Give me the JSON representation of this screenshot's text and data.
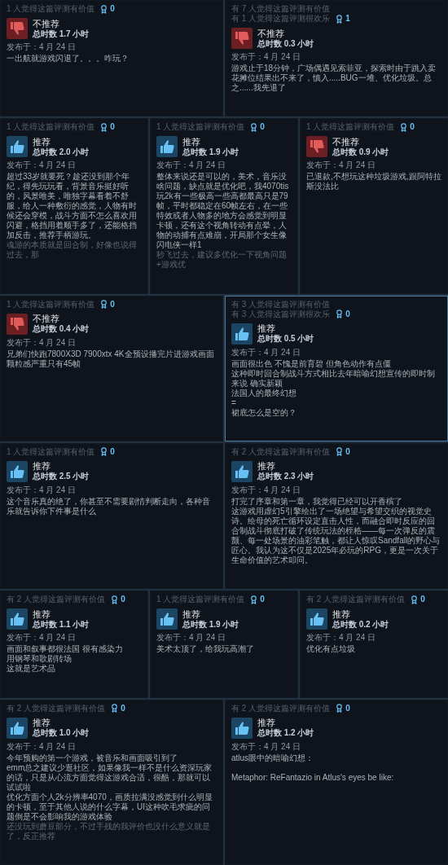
{
  "rows": [
    {
      "reviews": [
        {
          "helpful": [
            "1 人觉得这篇评测有价值"
          ],
          "awards": "0",
          "kind": "down",
          "verdict": "不推荐",
          "hours": "总时数 1.7 小时",
          "posted": "发布于：4 月 24 日",
          "lines": [
            "一出航就游戏闪退了。。。咋玩？"
          ],
          "highlighted": false
        },
        {
          "helpful": [
            "有 7 人觉得这篇评测有价值",
            "有 1 人觉得这篇评测很欢乐"
          ],
          "awards": "1",
          "kind": "down",
          "verdict": "不推荐",
          "hours": "总时数 0.3 小时",
          "posted": "发布于：4 月 24 日",
          "lines": [
            "游戏止于18分钟，广场偶遇见索菲亚，探索时由于跳入卖花摊位结果出不来了，慎入.....BUG一堆、优化垃圾。总之......我先退了"
          ],
          "highlighted": false
        }
      ]
    },
    {
      "reviews": [
        {
          "helpful": [
            "1 人觉得这篇评测有价值"
          ],
          "awards": "0",
          "kind": "up",
          "verdict": "推荐",
          "hours": "总时数 2.0 小时",
          "posted": "发布于：4 月 24 日",
          "lines": [
            "超过33岁就要死？趁还没到那个年纪，得先玩玩看，背景音乐挺好听的，风景唯美，唯独字幕看着不舒服，给人一种敷衍的感觉，人物有时候还会穿模，战斗方面不怎么喜欢用闪避，格挡用着顺手多了，还能格挡加反击，推荐手柄游玩。"
          ],
          "faded": "魂游的本质就是回合制，好像也说得过去，那",
          "highlighted": false
        },
        {
          "helpful": [
            "1 人觉得这篇评测有价值"
          ],
          "awards": "0",
          "kind": "up",
          "verdict": "推荐",
          "hours": "总时数 1.9 小时",
          "posted": "发布于：4 月 24 日",
          "lines": [
            "整体来说还是可以的，美术，音乐没啥问题，缺点就是优化吧，我4070tis玩2k有一些极高一些高都最高只是79帧，平时都稳定在60帧左右，在一些特效或者人物多的地方会感觉到明显卡顿，还有这个视角转动有点晕，人物的动捕有点难崩，开局那个女生像闪电侠一样1"
          ],
          "faded": "秒飞过去，建议多优化一下视角问题+游戏优",
          "highlighted": false
        },
        {
          "helpful": [
            "1 人觉得这篇评测有价值"
          ],
          "awards": "0",
          "kind": "down",
          "verdict": "不推荐",
          "hours": "总时数 0.9 小时",
          "posted": "发布于：4 月 24 日",
          "lines": [
            "已退款,不想玩这种垃圾游戏,跟阿特拉斯没法比"
          ],
          "highlighted": false
        }
      ]
    },
    {
      "reviews": [
        {
          "helpful": [
            "1 人觉得这篇评测有价值"
          ],
          "awards": "0",
          "kind": "down",
          "verdict": "不推荐",
          "hours": "总时数 0.4 小时",
          "posted": "发布于：4 月 24 日",
          "lines": [
            "兄弟们快跑7800X3D 7900xtx 4K全预设播完片进游戏画面颗粒感严重只有45帧"
          ],
          "highlighted": false
        },
        {
          "helpful": [
            "有 3 人觉得这篇评测有价值",
            "有 3 人觉得这篇评测很欢乐"
          ],
          "awards": "0",
          "kind": "up",
          "verdict": "推荐",
          "hours": "总时数 0.5 小时",
          "posted": "发布于：4 月 24 日",
          "lines": [
            "画面很出色 不愧是前育碧 但角色动作有点僵",
            "这种即时回合制战斗方式相比去年暗喻幻想宣传的即时制来说 确实新颖",
            "法国人的最终幻想",
            "=",
            "裙底怎么是空的？"
          ],
          "highlighted": true
        }
      ]
    },
    {
      "reviews": [
        {
          "helpful": [
            "1 人觉得这篇评测有价值"
          ],
          "awards": "0",
          "kind": "up",
          "verdict": "推荐",
          "hours": "总时数 2.5 小时",
          "posted": "发布于：4 月 24 日",
          "lines": [
            "这个音乐真的绝了，你甚至不需要剧情判断走向，各种音乐就告诉你下件事是什么"
          ],
          "highlighted": false
        },
        {
          "helpful": [
            "有 2 人觉得这篇评测有价值"
          ],
          "awards": "0",
          "kind": "up",
          "verdict": "推荐",
          "hours": "总时数 2.3 小时",
          "posted": "发布于：4 月 24 日",
          "lines": [
            "打完了序章和第一章，我觉得已经可以开香槟了",
            "这游戏用虚幻5引擎绘出了一场绝望与希望交织的视觉史诗。绘母的死亡循环设定直击人性，而融合即时反应的回合制战斗彻底打破了传统玩法的桎梏——每一次弹反的震颤、每一处场景的油彩笔触，都让人惊叹Sandfall的野心与匠心。我认为这不仅是2025年必玩的RPG，更是一次关于生命价值的艺术叩问。"
          ],
          "highlighted": false
        }
      ]
    },
    {
      "reviews": [
        {
          "helpful": [
            "有 2 人觉得这篇评测有价值"
          ],
          "awards": "0",
          "kind": "up",
          "verdict": "推荐",
          "hours": "总时数 1.1 小时",
          "posted": "发布于：4 月 24 日",
          "lines": [
            "画面和叙事都很法国 很有感染力",
            "用钢琴和歌剧转场",
            "这就是艺术品"
          ],
          "highlighted": false
        },
        {
          "helpful": [
            "1 人觉得这篇评测有价值"
          ],
          "awards": "0",
          "kind": "up",
          "verdict": "推荐",
          "hours": "总时数 1.9 小时",
          "posted": "发布于：4 月 24 日",
          "lines": [
            "美术太顶了，给我玩高潮了"
          ],
          "highlighted": false
        },
        {
          "helpful": [
            "有 2 人觉得这篇评测有价值"
          ],
          "awards": "0",
          "kind": "up",
          "verdict": "推荐",
          "hours": "总时数 0.2 小时",
          "posted": "发布于：4 月 24 日",
          "lines": [
            "优化有点垃圾"
          ],
          "highlighted": false
        }
      ]
    },
    {
      "reviews": [
        {
          "helpful": [
            "有 2 人觉得这篇评测有价值"
          ],
          "awards": "0",
          "kind": "up",
          "verdict": "推荐",
          "hours": "总时数 1.0 小时",
          "posted": "发布于：4 月 24 日",
          "lines": [
            "今年预购的第一个游戏，被音乐和画面吸引到了",
            "emm总之建议少逛社区，如果像我一样不是什么资深玩家的话，只是从心流方面觉得这游戏合适，很酷，那就可以试试啦",
            "优化方面个人2k分辨率4070，画质拉满没感觉到什么明显的卡顿，至于其他人说的什么字幕，UI这种吹毛求疵的问题倒是不会影响我的游戏体验"
          ],
          "faded": "还没玩到蘑豆部分，不过手残的我评价也没什么意义就是了，反正推荐",
          "highlighted": false
        },
        {
          "helpful": [
            "有 2 人觉得这篇评测有价值"
          ],
          "awards": "0",
          "kind": "up",
          "verdict": "推荐",
          "hours": "总时数 1.2 小时",
          "posted": "发布于：4 月 24 日",
          "lines": [
            "atlus眼中的暗喻幻想：",
            "Metaphor: ReFantazio in Atlus's eyes be like:"
          ],
          "blank_after_first": true,
          "highlighted": false
        }
      ]
    }
  ]
}
